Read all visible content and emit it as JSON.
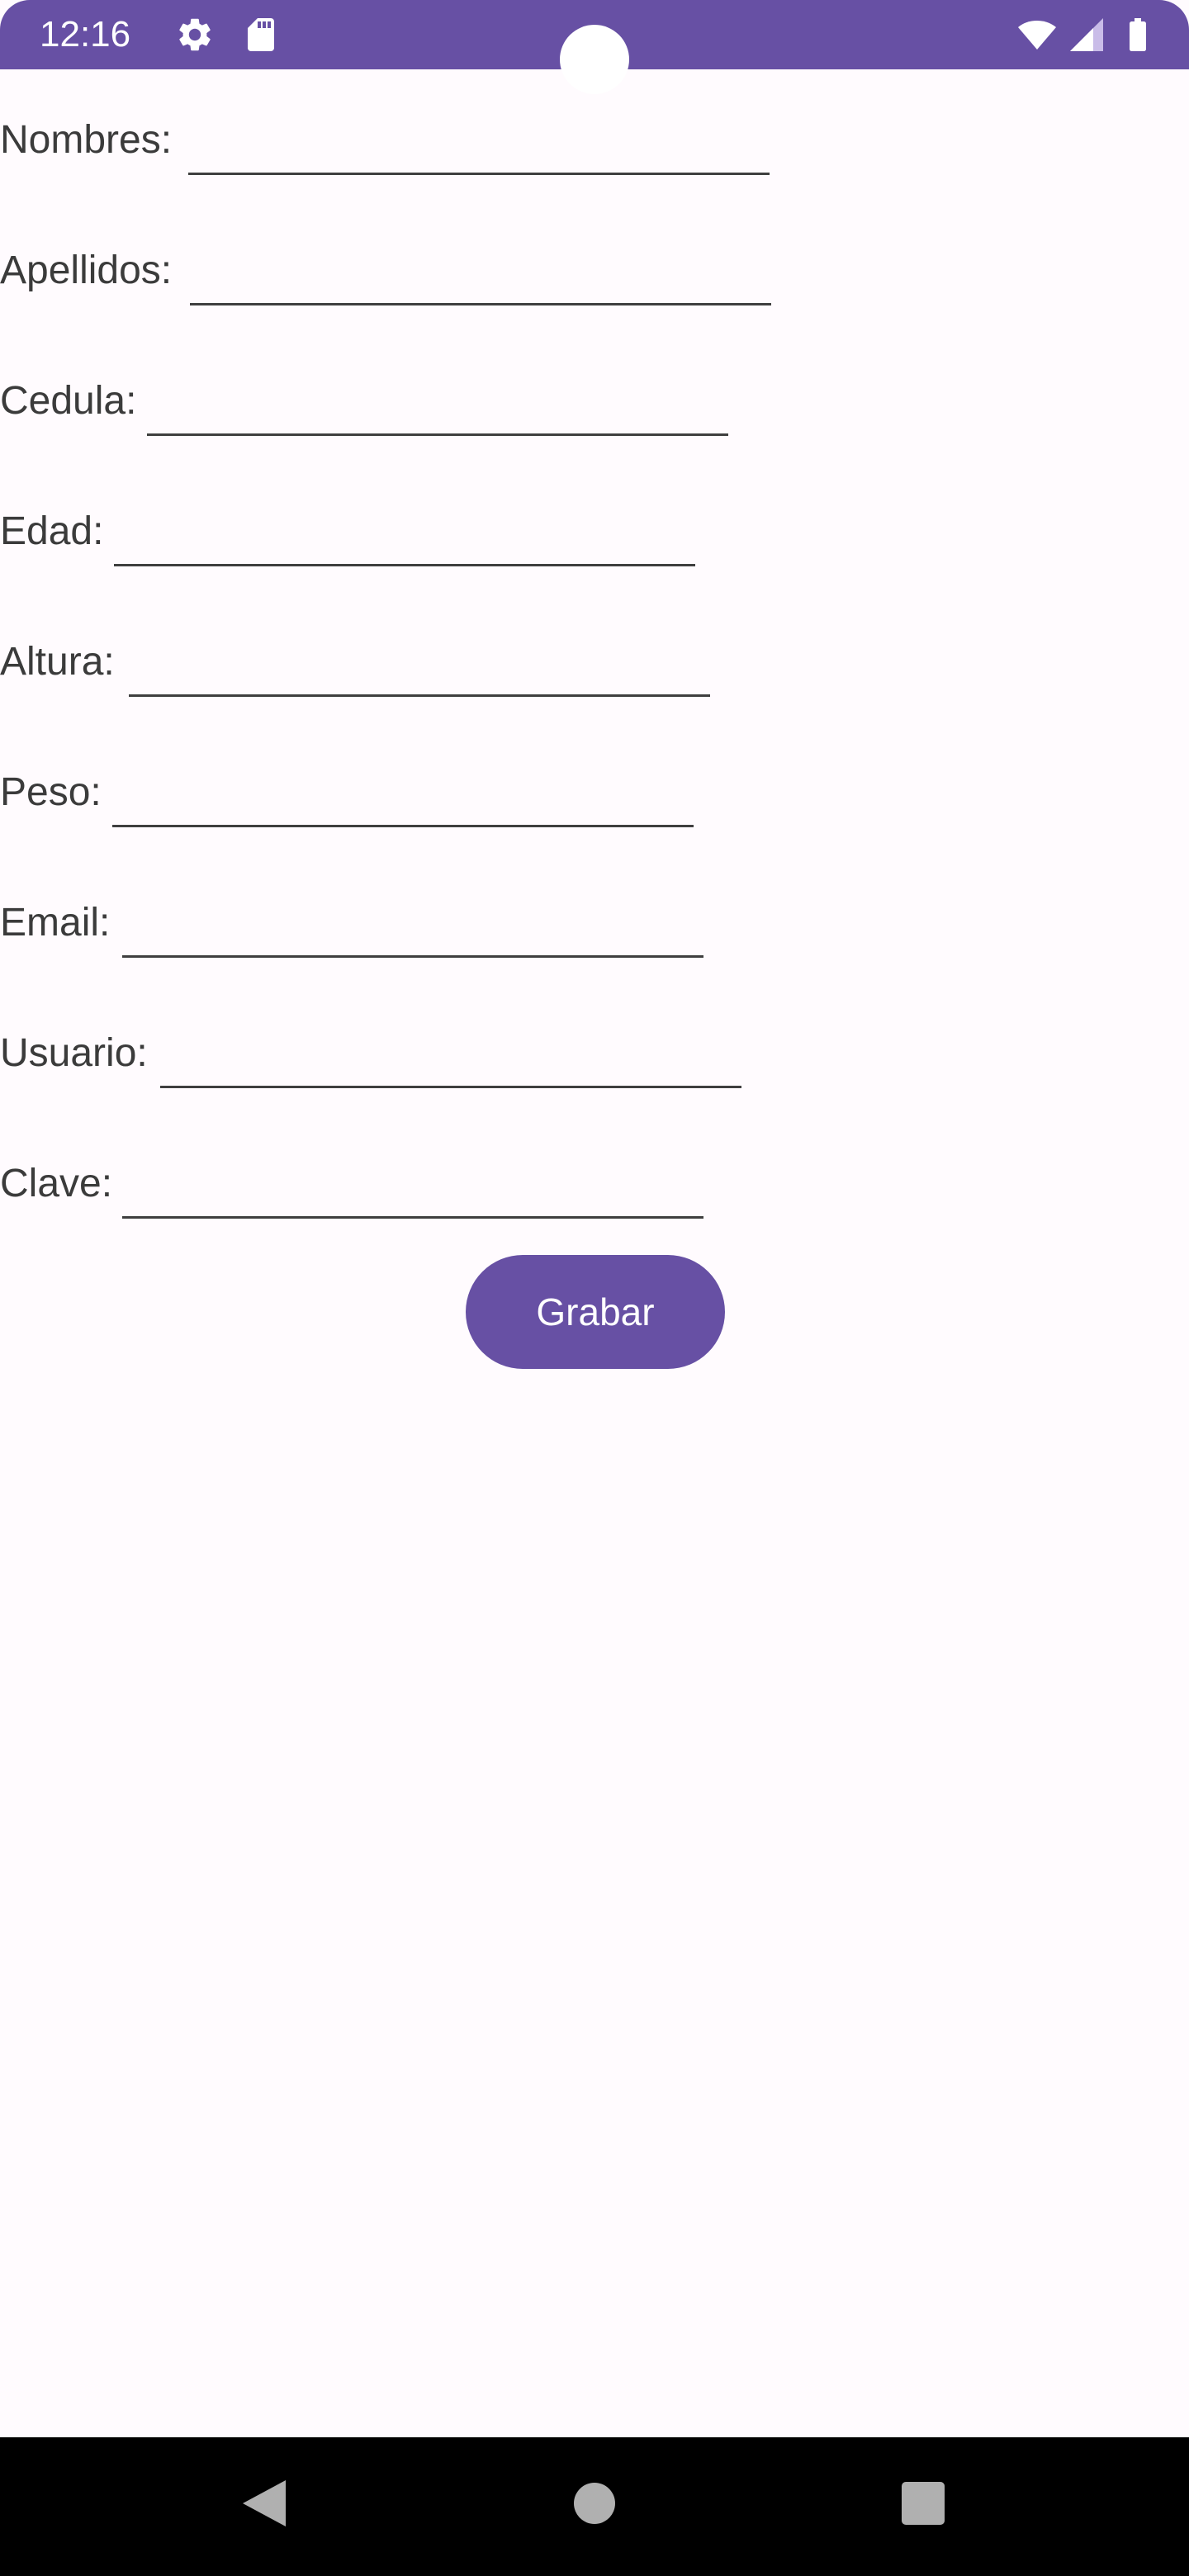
{
  "status_bar": {
    "time": "12:16",
    "icons": [
      "settings-icon",
      "sd-card-icon",
      "wifi-icon",
      "cell-signal-icon",
      "battery-icon"
    ],
    "color": "#6750A4"
  },
  "form": {
    "fields": [
      {
        "label": "Nombres:",
        "value": "",
        "placeholder": ""
      },
      {
        "label": "Apellidos:",
        "value": "",
        "placeholder": ""
      },
      {
        "label": "Cedula:",
        "value": "",
        "placeholder": ""
      },
      {
        "label": "Edad:",
        "value": "",
        "placeholder": ""
      },
      {
        "label": "Altura:",
        "value": "",
        "placeholder": ""
      },
      {
        "label": "Peso:",
        "value": "",
        "placeholder": ""
      },
      {
        "label": "Email:",
        "value": "",
        "placeholder": ""
      },
      {
        "label": "Usuario:",
        "value": "",
        "placeholder": ""
      },
      {
        "label": "Clave:",
        "value": "",
        "placeholder": ""
      }
    ],
    "save_label": "Grabar"
  },
  "nav_bar": {
    "icons": [
      "back-icon",
      "home-icon",
      "recents-icon"
    ]
  },
  "colors": {
    "accent": "#6750A4",
    "background": "#FFFBFE",
    "nav_background": "#000000"
  }
}
